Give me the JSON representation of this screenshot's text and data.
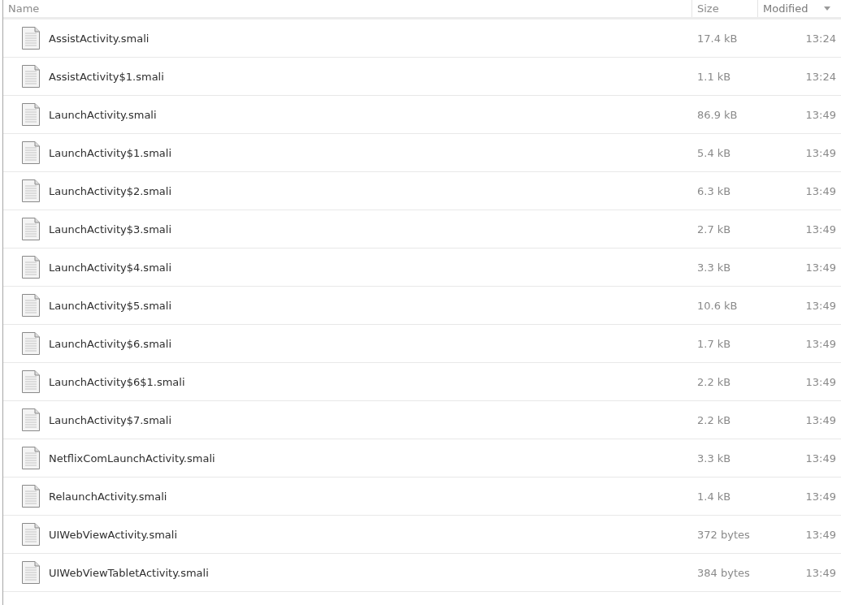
{
  "table": {
    "columns": [
      {
        "label": "Name",
        "sorted": false
      },
      {
        "label": "Size",
        "sorted": false
      },
      {
        "label": "Modified",
        "sorted": true
      }
    ],
    "rows": [
      {
        "name": "AssistActivity.smali",
        "size": "17.4 kB",
        "modified": "13:24"
      },
      {
        "name": "AssistActivity$1.smali",
        "size": "1.1 kB",
        "modified": "13:24"
      },
      {
        "name": "LaunchActivity.smali",
        "size": "86.9 kB",
        "modified": "13:49"
      },
      {
        "name": "LaunchActivity$1.smali",
        "size": "5.4 kB",
        "modified": "13:49"
      },
      {
        "name": "LaunchActivity$2.smali",
        "size": "6.3 kB",
        "modified": "13:49"
      },
      {
        "name": "LaunchActivity$3.smali",
        "size": "2.7 kB",
        "modified": "13:49"
      },
      {
        "name": "LaunchActivity$4.smali",
        "size": "3.3 kB",
        "modified": "13:49"
      },
      {
        "name": "LaunchActivity$5.smali",
        "size": "10.6 kB",
        "modified": "13:49"
      },
      {
        "name": "LaunchActivity$6.smali",
        "size": "1.7 kB",
        "modified": "13:49"
      },
      {
        "name": "LaunchActivity$6$1.smali",
        "size": "2.2 kB",
        "modified": "13:49"
      },
      {
        "name": "LaunchActivity$7.smali",
        "size": "2.2 kB",
        "modified": "13:49"
      },
      {
        "name": "NetflixComLaunchActivity.smali",
        "size": "3.3 kB",
        "modified": "13:49"
      },
      {
        "name": "RelaunchActivity.smali",
        "size": "1.4 kB",
        "modified": "13:49"
      },
      {
        "name": "UIWebViewActivity.smali",
        "size": "372 bytes",
        "modified": "13:49"
      },
      {
        "name": "UIWebViewTabletActivity.smali",
        "size": "384 bytes",
        "modified": "13:49"
      }
    ]
  }
}
